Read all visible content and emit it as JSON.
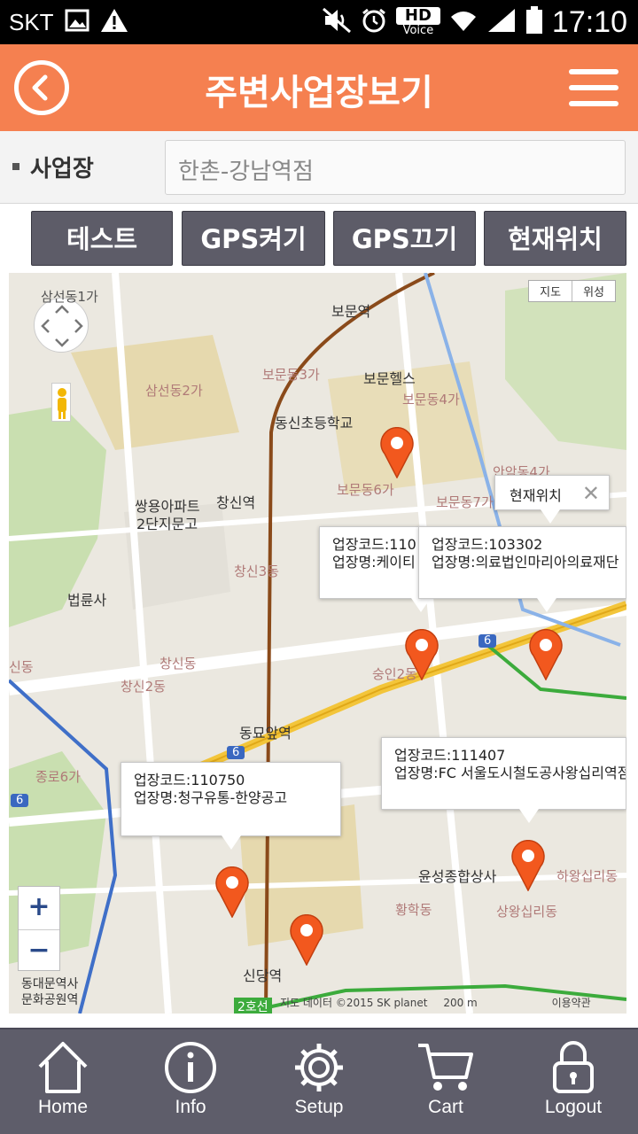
{
  "status_bar": {
    "carrier": "SKT",
    "hd_label": "HD",
    "voice_label": "Voice",
    "time": "17:10"
  },
  "header": {
    "title": "주변사업장보기"
  },
  "business": {
    "label": "사업장",
    "value": "한촌-강남역점"
  },
  "buttons": {
    "test": "테스트",
    "gps_on": "GPS켜기",
    "gps_off": "GPS끄기",
    "current_location": "현재위치"
  },
  "map": {
    "type_map": "지도",
    "type_satellite": "위성",
    "labels": {
      "samseon1": "삼선동1가",
      "bomun_station": "보문역",
      "bomun3": "보문동3가",
      "bomun_hills": "보문헬스",
      "bomun4": "보문동4가",
      "samseon2": "삼선동2가",
      "dongsin_school": "동신초등학교",
      "anam4": "안암동4가",
      "bomun6": "보문동6가",
      "bomun7": "보문동7가",
      "ssangyong": "쌍용아파트",
      "dangi": "2단지문고",
      "changsin_station": "창신역",
      "changsin3": "창신3동",
      "beopryunsa": "법륜사",
      "sindong": "신동",
      "changsin_dong": "창신동",
      "changsin2": "창신2동",
      "sungin2": "숭인2동",
      "dongmyo_station": "동묘앞역",
      "jongno6": "종로6가",
      "yunseong": "윤성종합상사",
      "hawangsimni": "하왕십리동",
      "hwanghak": "황학동",
      "sangwangsimni": "상왕십리동",
      "dongdaemun_station": "동대문역사",
      "munhwa_park": "문화공원역",
      "sindang_station": "신당역",
      "line2": "2호선",
      "route6a": "6",
      "route6b": "6",
      "route6c": "6"
    },
    "current_location_popup": "현재위치",
    "zoom_in": "+",
    "zoom_out": "−",
    "attribution": "지도 데이터 ©2015 SK planet",
    "scale": "200 m",
    "terms": "이용약관",
    "info_windows": [
      {
        "code_label": "업장코드:",
        "code": "110",
        "name_label": "업장명:",
        "name": "케이티"
      },
      {
        "code_label": "업장코드:",
        "code": "103302",
        "name_label": "업장명:",
        "name": "의료법인마리아의료재단"
      },
      {
        "code_label": "업장코드:",
        "code": "111407",
        "name_label": "업장명:",
        "name": "FC 서울도시철도공사왕십리역점"
      },
      {
        "code_label": "업장코드:",
        "code": "110750",
        "name_label": "업장명:",
        "name": "청구유통-한양공고"
      }
    ]
  },
  "bottom_nav": {
    "home": "Home",
    "info": "Info",
    "setup": "Setup",
    "cart": "Cart",
    "logout": "Logout"
  },
  "colors": {
    "header": "#f58050",
    "nav": "#5e5d6a",
    "pin": "#f2581e",
    "button": "#5d5c68"
  }
}
